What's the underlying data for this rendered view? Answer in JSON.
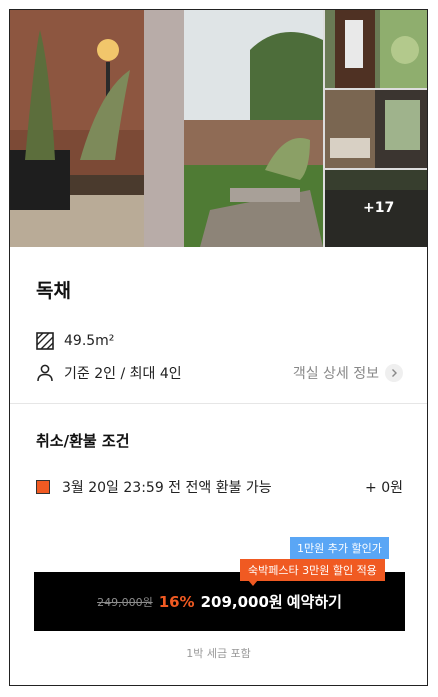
{
  "gallery": {
    "more_count": "+17"
  },
  "room": {
    "name": "독채",
    "area": "49.5m²",
    "capacity": "기준 2인 / 최대 4인",
    "detail_link": "객실 상세 정보"
  },
  "refund": {
    "title": "취소/환불 조건",
    "policy": "3월 20일 23:59 전 전액 환불 가능",
    "fee": "+ 0원",
    "marker_color": "#f05a22"
  },
  "promo": {
    "badge_extra": "1만원 추가 할인가",
    "badge_fest": "숙박페스타 3만원 할인 적용"
  },
  "cta": {
    "original_price": "249,000원",
    "discount": "16%",
    "price": "209,000원",
    "action": "예약하기"
  },
  "tax_note": "1박 세금 포함",
  "colors": {
    "accent": "#f05a22",
    "badge_blue": "#5aa6f5",
    "cta_bg": "#000000"
  }
}
